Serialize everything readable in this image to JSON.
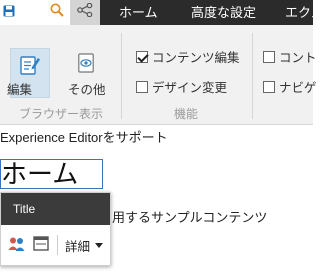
{
  "tabs": {
    "home": "ホーム",
    "advanced": "高度な設定",
    "experience": "エクス"
  },
  "ribbon": {
    "edit_label": "編集",
    "other_label": "その他",
    "browser_group_label": "ブラウザー表示",
    "function_group_label": "機能",
    "content_edit_label": "コンテンツ編集",
    "content_edit_checked": true,
    "design_change_label": "デザイン変更",
    "design_change_checked": false,
    "content_cut_label": "コント",
    "content_cut_checked": false,
    "navi_cut_label": "ナビゲ",
    "navi_cut_checked": false
  },
  "content": {
    "support_text": "Experience Editorをサポート",
    "heading_text": "ホーム",
    "sample_text": "用するサンプルコンテンツ"
  },
  "chrome": {
    "title": "Title",
    "more_label": "詳細"
  },
  "colors": {
    "topbar": "#2b2b2b",
    "accent": "#1e6fb8",
    "active_button": "#d3e3ef"
  },
  "icons": {
    "save": "floppy-disk",
    "search": "magnifier",
    "tree": "sitemap",
    "edit": "pencil-document",
    "other": "eye",
    "personalize": "users",
    "window": "window"
  }
}
